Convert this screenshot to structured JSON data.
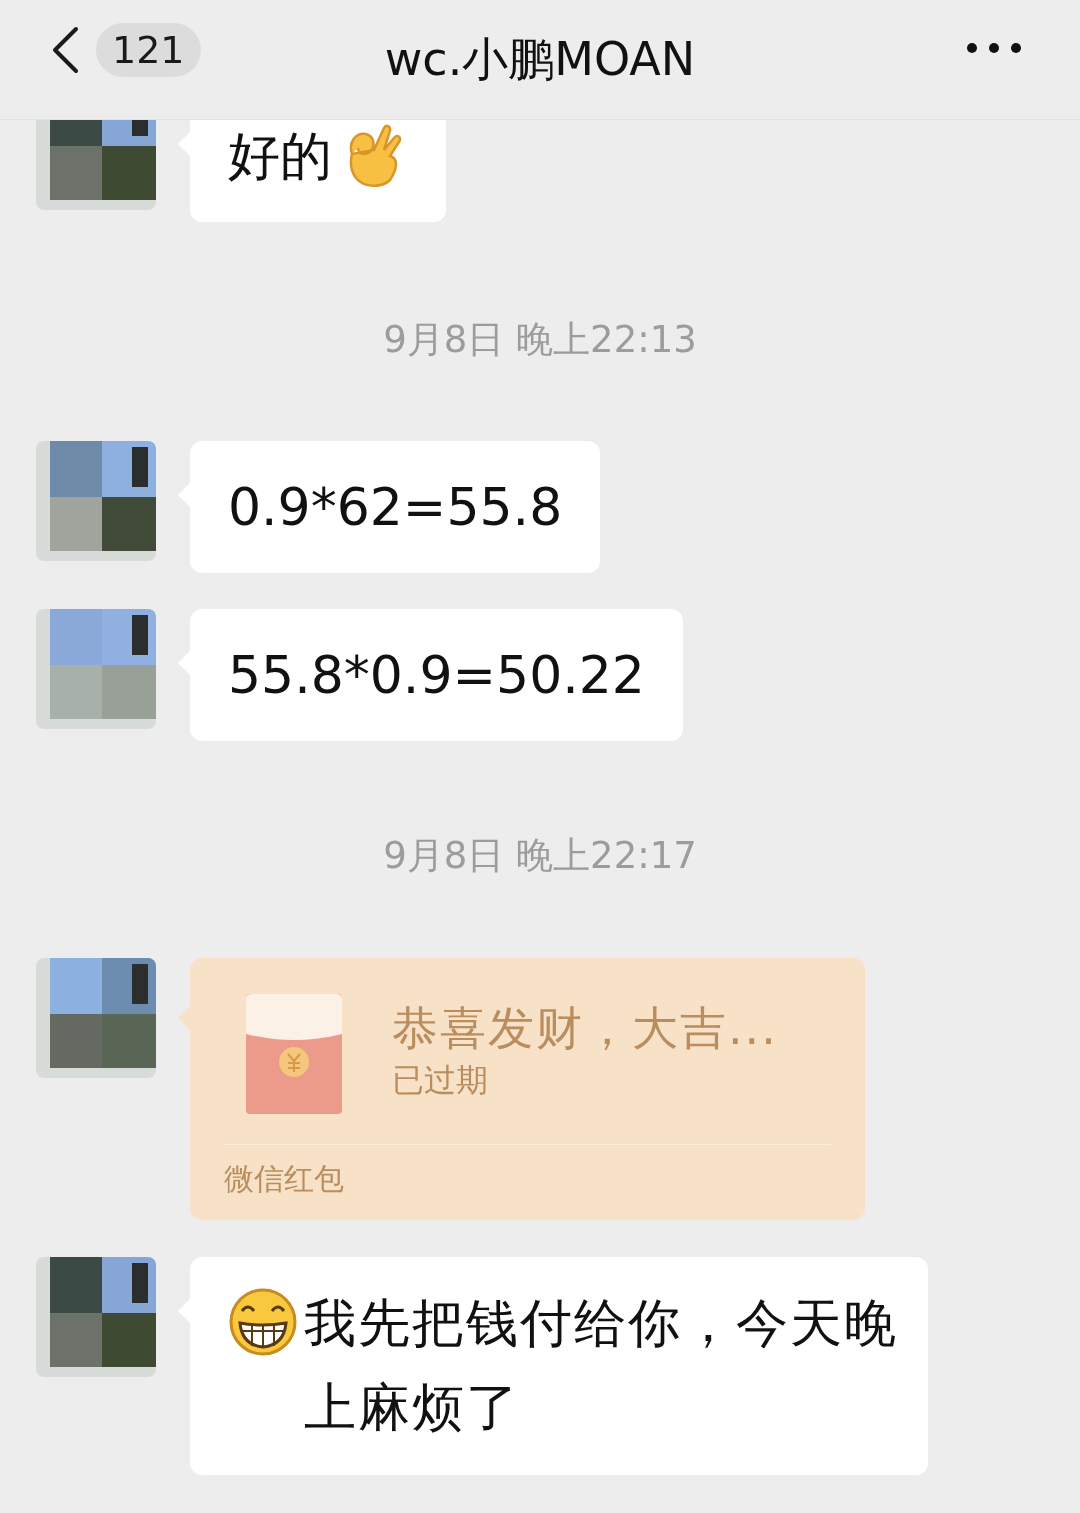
{
  "header": {
    "back_count": "121",
    "title": "wc.小鹏MOAN"
  },
  "items": [
    {
      "kind": "text_ok",
      "text": "好的"
    },
    {
      "kind": "time",
      "text": "9月8日 晚上22:13"
    },
    {
      "kind": "text",
      "text": "0.9*62=55.8"
    },
    {
      "kind": "text",
      "text": "55.8*0.9=50.22"
    },
    {
      "kind": "time",
      "text": "9月8日 晚上22:17"
    },
    {
      "kind": "red_packet",
      "title": "恭喜发财，大吉...",
      "status": "已过期",
      "footer": "微信红包"
    },
    {
      "kind": "grin_text",
      "text": "我先把钱付给你，今天晚上麻烦了"
    }
  ]
}
